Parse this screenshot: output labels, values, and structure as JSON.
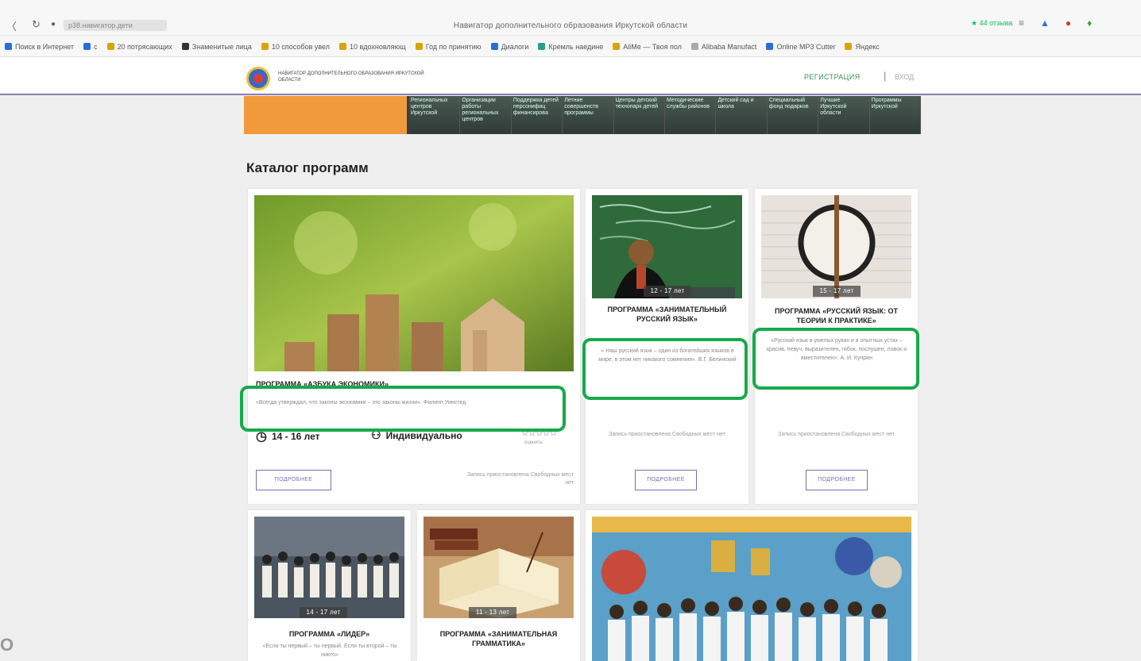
{
  "browser": {
    "tab_title": "Навигатор дополнительного образования Иркутской области",
    "url": "р38.навигатор.дети",
    "reviews": "★ 44 отзыва",
    "bookmarks": [
      "Поиск в Интернет",
      "с",
      "20 потрясающих",
      "Знаменитые лица",
      "10 способов увел",
      "10 вдохновляющ",
      "Год по принятию",
      "Диалоги",
      "Кремль наедине",
      "AliMe — Твоя пол",
      "Alibaba Manufact",
      "Online MP3 Cutter",
      "Яндекс"
    ]
  },
  "site": {
    "logo_text": "Навигатор дополнительного образования Иркутской области",
    "register": "РЕГИСТРАЦИЯ",
    "separator": "|",
    "login": "ВХОД"
  },
  "banner": {
    "tiles": [
      "Региональных центров Иркутской",
      "Организации работы региональных центров",
      "Поддержка детей персонифиц финансирова",
      "Летние совершенств программы",
      "Центры детский технопарк детей",
      "Методические службы районов",
      "Детский сад и школа",
      "Специальный фонд подарков",
      "Лучшие Иркутской области",
      "Программы Иркутской"
    ]
  },
  "catalog_title": "Каталог программ",
  "cards": [
    {
      "title": "ПРОГРАММА «АЗБУКА ЭКОНОМИКИ»",
      "quote": "«Всегда утверждал, что законы экономики – это законы жизни». Филипп Уинстед",
      "age": "14 - 16 лет",
      "format": "Индивидуально",
      "rate_label": "оценить",
      "note": "Запись приостановлена Свободных мест нет",
      "button": "ПОДРОБНЕЕ"
    },
    {
      "age": "12 - 17 лет",
      "title": "ПРОГРАММА «ЗАНИМАТЕЛЬНЫЙ РУССКИЙ ЯЗЫК»",
      "quote": "« Наш русский язык – один из богатейших языков в мире, в этом нет никакого сомнения». В.Г. Белинский",
      "note": "Запись приостановлена Свободных мест нет",
      "button": "ПОДРОБНЕЕ"
    },
    {
      "age": "15 - 17 лет",
      "title": "ПРОГРАММА «РУССКИЙ ЯЗЫК: ОТ ТЕОРИИ К ПРАКТИКЕ»",
      "quote": "«Русский язык в умелых руках и в опытных устах – красив, певуч, выразителен, гибок, послушен, ловок и вместителен». А. И. Куприн",
      "note": "Запись приостановлена Свободных мест нет",
      "button": "ПОДРОБНЕЕ"
    },
    {
      "age": "14 - 17 лет",
      "title": "ПРОГРАММА «ЛИДЕР»",
      "quote": "«Если ты первый – ты первый. Если ты второй – ты никто»"
    },
    {
      "age": "11 - 13 лет",
      "title": "ПРОГРАММА «ЗАНИМАТЕЛЬНАЯ ГРАММАТИКА»"
    }
  ],
  "colors": {
    "accent": "#7b6fb0",
    "highlight": "#17a94a",
    "orange": "#f19a3c"
  },
  "watermark": "O"
}
